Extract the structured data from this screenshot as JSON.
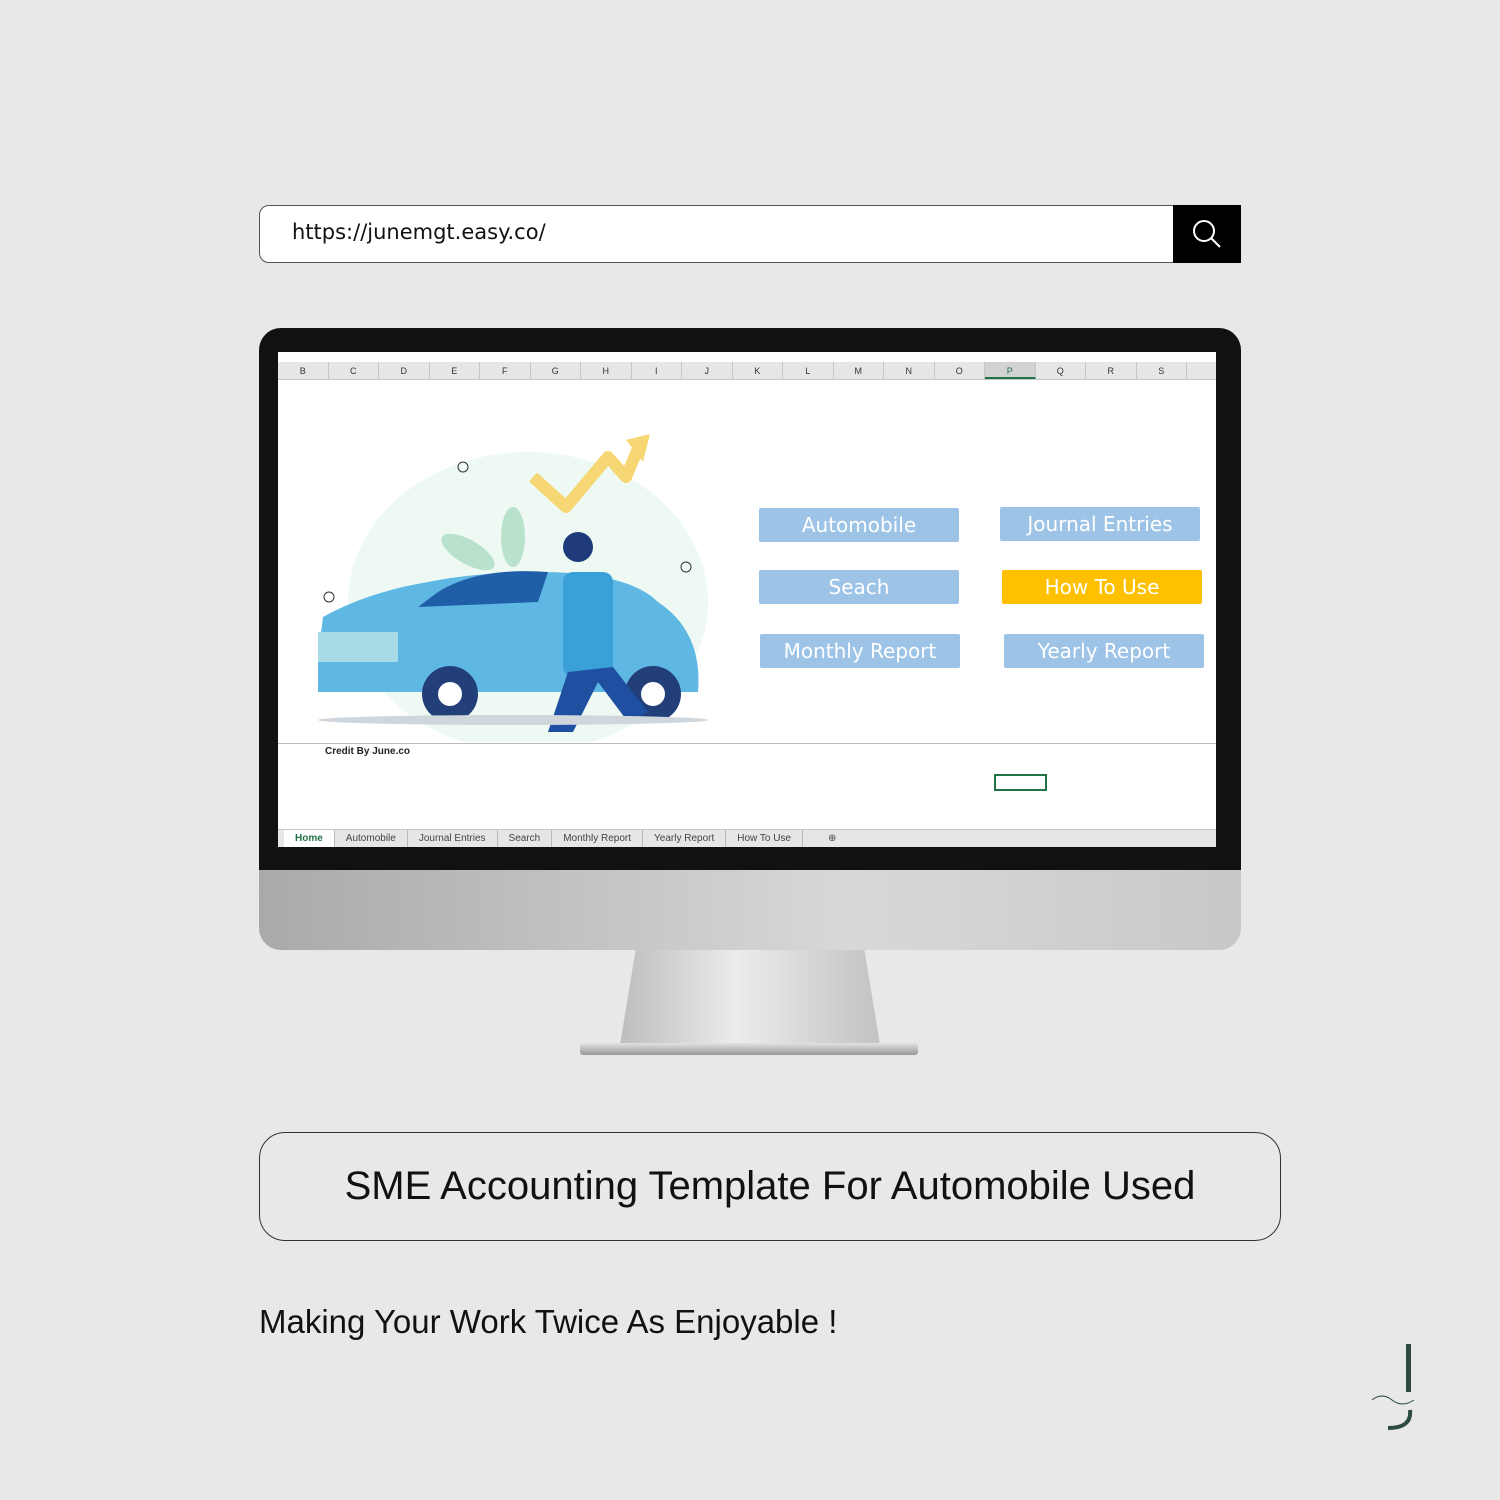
{
  "browser": {
    "url": "https://junemgt.easy.co/",
    "search_icon": "search-icon"
  },
  "spreadsheet": {
    "columns": [
      "B",
      "C",
      "D",
      "E",
      "F",
      "G",
      "H",
      "I",
      "J",
      "K",
      "L",
      "M",
      "N",
      "O",
      "P",
      "Q",
      "R",
      "S"
    ],
    "selected_column": "P",
    "buttons": [
      {
        "label": "Automobile",
        "color": "#9dc3e6"
      },
      {
        "label": "Journal Entries",
        "color": "#9dc3e6"
      },
      {
        "label": "Seach",
        "color": "#9dc3e6"
      },
      {
        "label": "How To Use",
        "color": "#ffc000"
      },
      {
        "label": "Monthly Report",
        "color": "#9dc3e6"
      },
      {
        "label": "Yearly Report",
        "color": "#9dc3e6"
      }
    ],
    "credit": "Credit By June.co",
    "sheet_tabs": [
      "Home",
      "Automobile",
      "Journal Entries",
      "Search",
      "Monthly Report",
      "Yearly Report",
      "How To Use"
    ],
    "active_tab": "Home",
    "accent": "#217346"
  },
  "title": "SME Accounting Template For Automobile Used",
  "tagline": "Making Your Work Twice As Enjoyable !",
  "logo": {
    "text": "June.co",
    "letter": "J",
    "color": "#2d4a42"
  }
}
